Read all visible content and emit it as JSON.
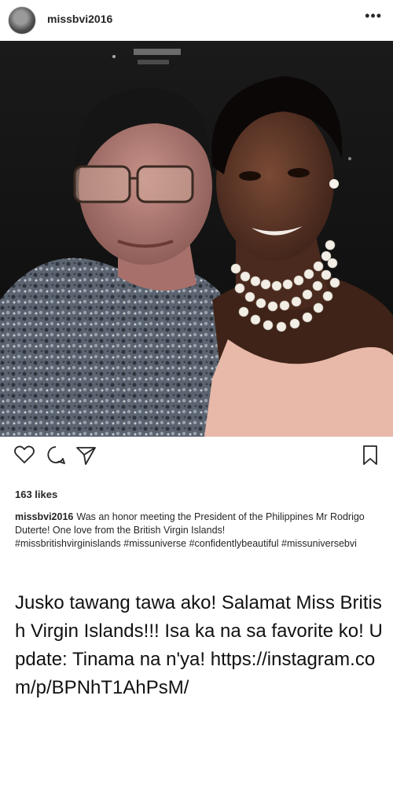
{
  "post": {
    "username": "missbvi2016",
    "more_icon": "more-horizontal-icon",
    "likes": "163 likes",
    "caption": {
      "username": "missbvi2016",
      "text": "Was an honor meeting the President of the Philippines Mr Rodrigo Duterte! One love from the British Virgin Islands!",
      "hashtags": "#missbritishvirginislands #missuniverse #confidentlybeautiful #missuniversebvi"
    },
    "icons": {
      "like": "heart-icon",
      "comment": "comment-icon",
      "share": "send-icon",
      "save": "bookmark-icon"
    }
  },
  "overlay_text": "Jusko tawang tawa ako! Salamat Miss British Virgin Islands!!! Isa ka na sa favorite ko! Update: Tinama na n'ya! https://instagram.com/p/BPNhT1AhPsM/"
}
